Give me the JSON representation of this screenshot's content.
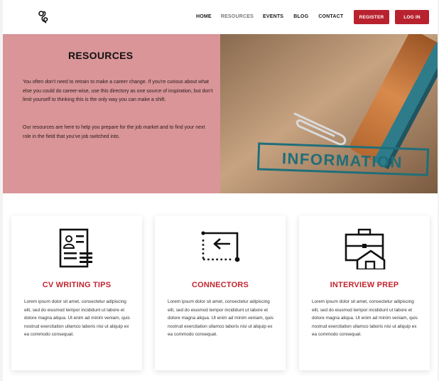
{
  "header": {
    "nav": [
      {
        "label": "HOME",
        "active": false
      },
      {
        "label": "RESOURCES",
        "active": true
      },
      {
        "label": "EVENTS",
        "active": false
      },
      {
        "label": "BLOG",
        "active": false
      },
      {
        "label": "CONTACT",
        "active": false
      }
    ],
    "register_label": "REGISTER",
    "login_label": "LOG IN"
  },
  "hero": {
    "title": "RESOURCES",
    "paragraph1": "You often don't need to retrain to make a career change. If you're curious about what else you could do career-wise, use this directory as one source of inspiration, but don't limit yourself to thinking this is the only way you can make a shift.",
    "paragraph2": "Our resources are here to help you prepare for the job market and to find your next role in the field that you've job switched into.",
    "image_stamp_text": "INFORMATION"
  },
  "cards": [
    {
      "title": "CV WRITING TIPS",
      "icon": "cv-document-icon",
      "text": "Lorem ipsum dolor sit amet, consectetur adipiscing elit, sed do eiusmod tempor incididunt ut labore et dolore magna aliqua. Ut enim ad minim veniam, quis nostrud exercitation ullamco laboris nisi ut aliquip ex ea commodo consequat."
    },
    {
      "title": "CONNECTORS",
      "icon": "connector-arrows-icon",
      "text": "Lorem ipsum dolor sit amet, consectetur adipiscing elit, sed do eiusmod tempor incididunt ut labore et dolore magna aliqua. Ut enim ad minim veniam, quis nostrud exercitation ullamco laboris nisi ut aliquip ex ea commodo consequat."
    },
    {
      "title": "INTERVIEW PREP",
      "icon": "briefcase-icon",
      "text": "Lorem ipsum dolor sit amet, consectetur adipiscing elit, sed do eiusmod tempor incididunt ut labore et dolore magna aliqua. Ut enim ad minim veniam, quis nostrud exercitation ullamco laboris nisi ut aliquip ex ea commodo consequat."
    }
  ],
  "colors": {
    "accent": "#b8222e",
    "hero_bg": "#d99598",
    "card_title": "#c0252f"
  }
}
